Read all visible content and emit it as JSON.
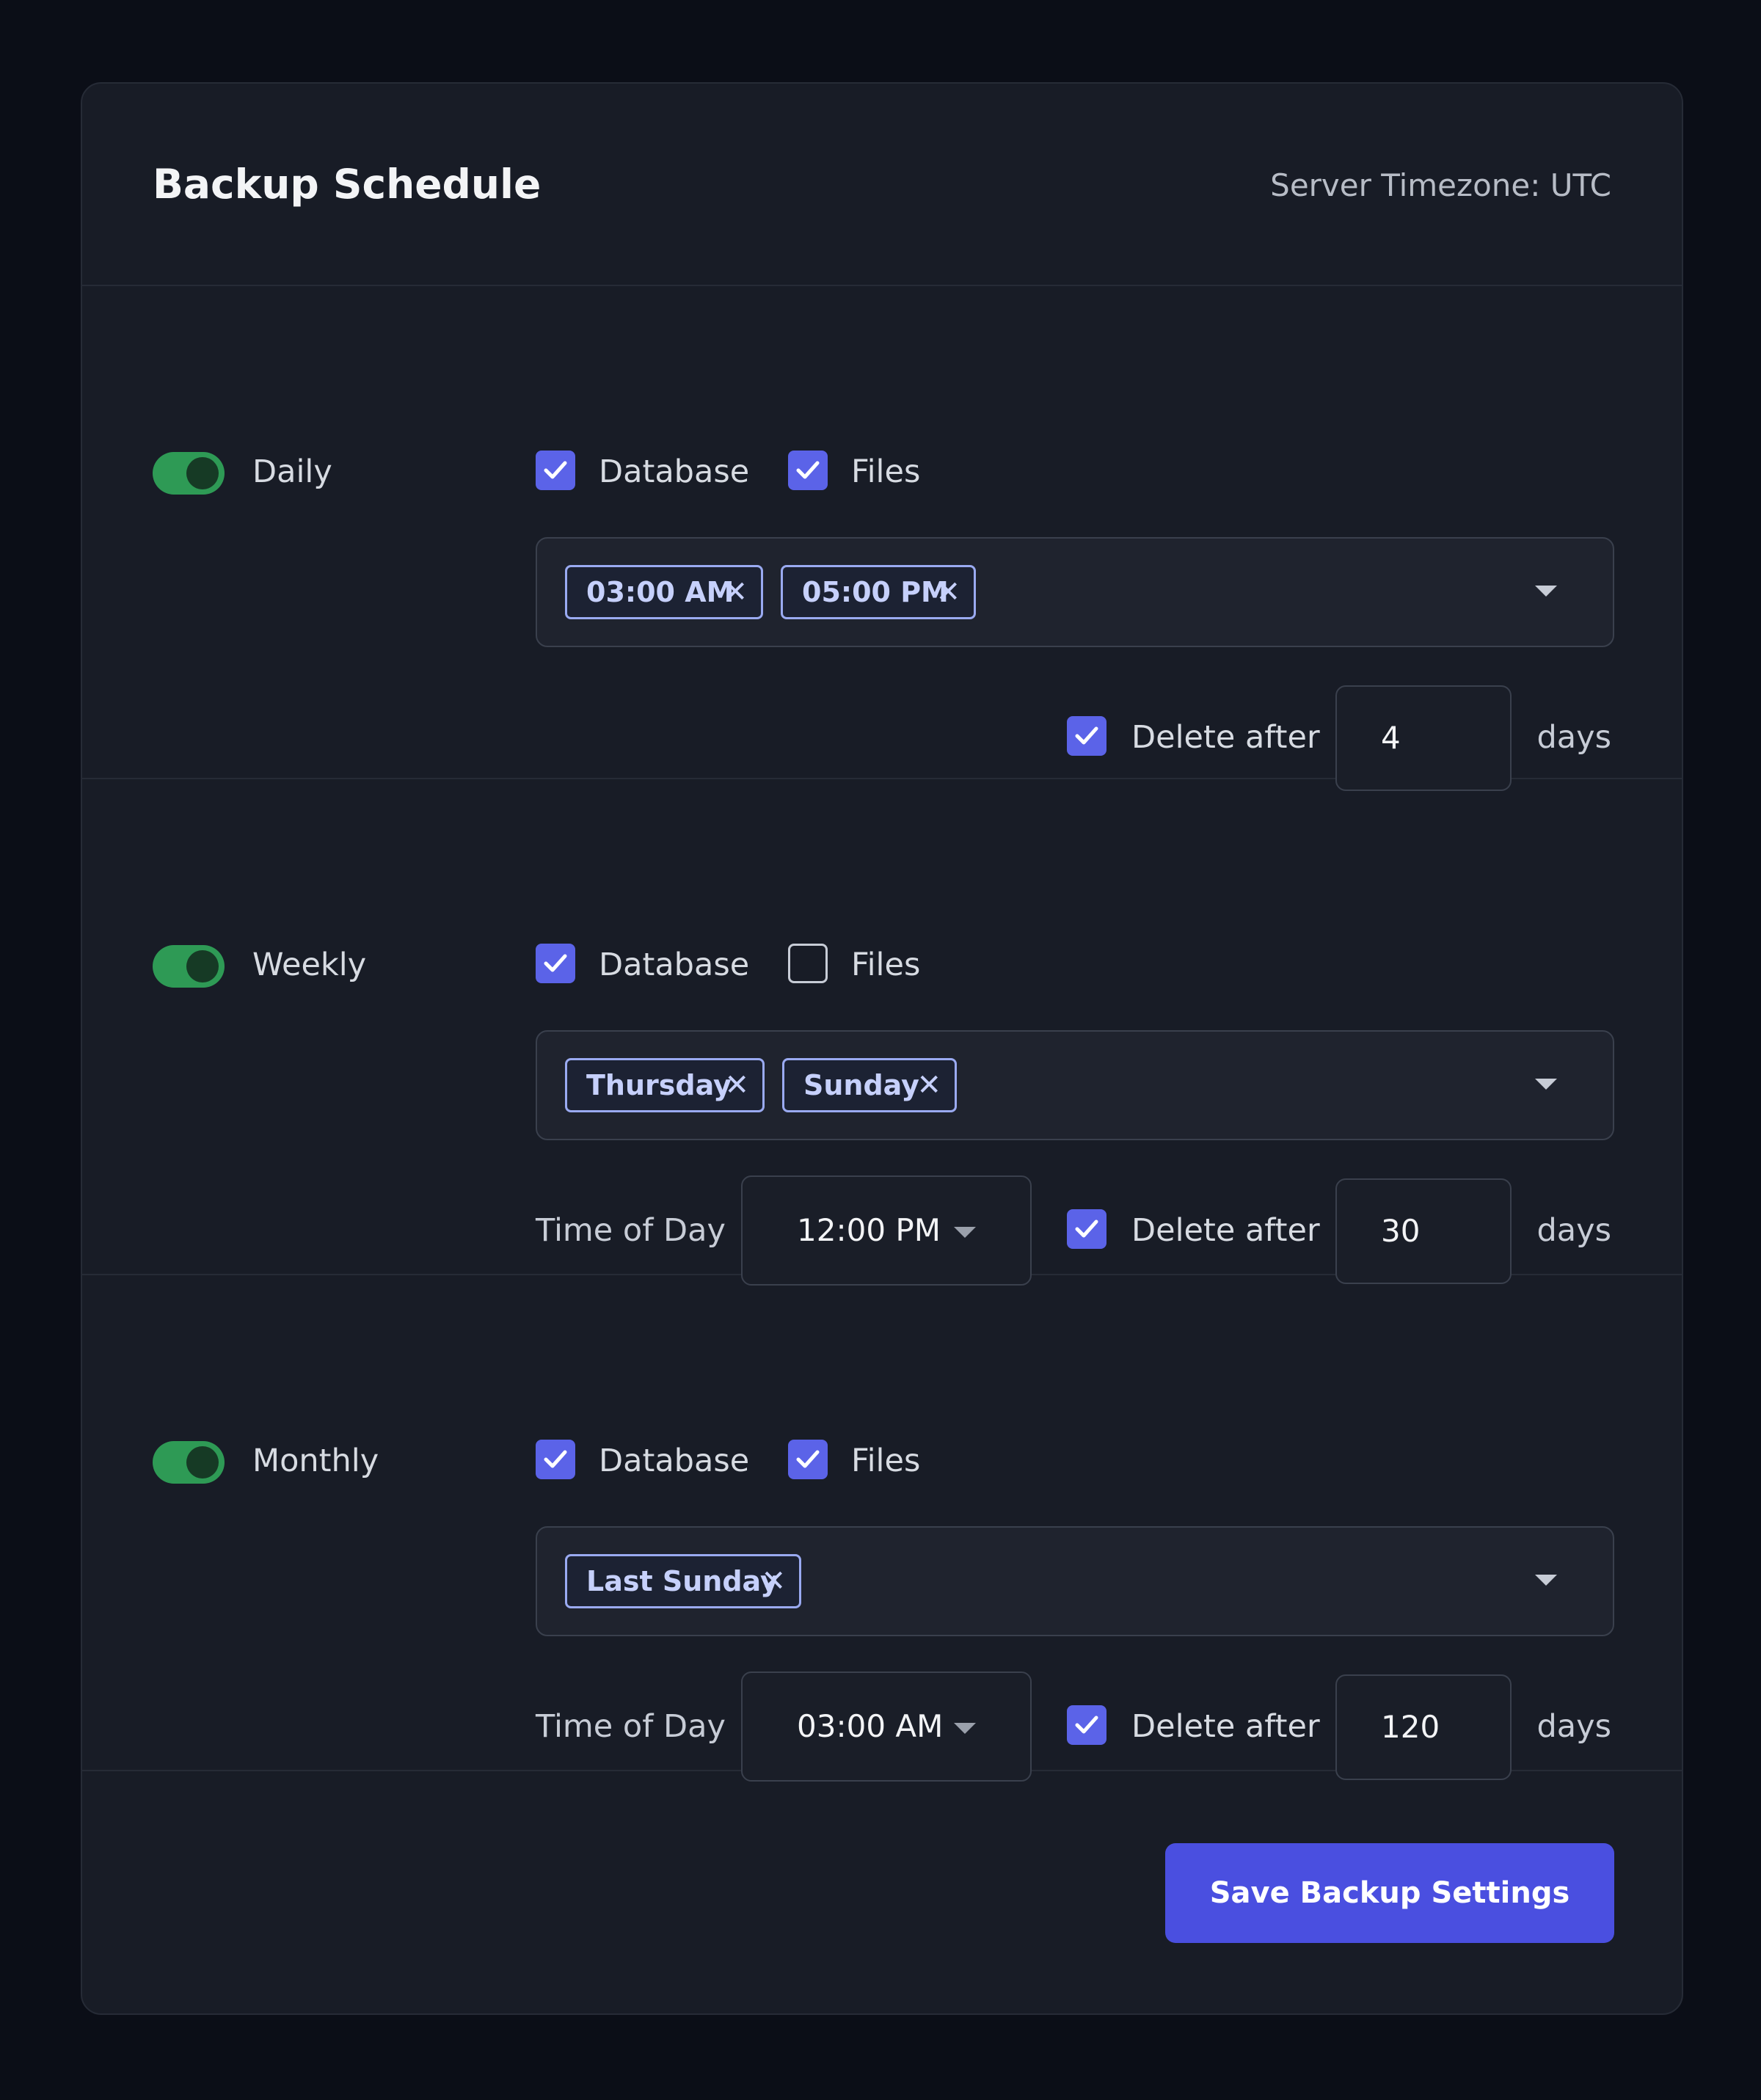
{
  "header": {
    "title": "Backup Schedule",
    "timezone": "Server Timezone: UTC"
  },
  "labels": {
    "database": "Database",
    "files": "Files",
    "time_of_day": "Time of Day",
    "delete_after": "Delete after",
    "days": "days"
  },
  "schedules": [
    {
      "name": "Daily",
      "enabled": true,
      "database_checked": true,
      "files_checked": true,
      "tags": [
        "03:00 AM",
        "05:00 PM"
      ],
      "delete_after_checked": true,
      "delete_after_days": "4"
    },
    {
      "name": "Weekly",
      "enabled": true,
      "database_checked": true,
      "files_checked": false,
      "tags": [
        "Thursday",
        "Sunday"
      ],
      "time_of_day": "12:00 PM",
      "delete_after_checked": true,
      "delete_after_days": "30"
    },
    {
      "name": "Monthly",
      "enabled": true,
      "database_checked": true,
      "files_checked": true,
      "tags": [
        "Last Sunday"
      ],
      "time_of_day": "03:00 AM",
      "delete_after_checked": true,
      "delete_after_days": "120"
    }
  ],
  "tag_remove_glyph": "✕",
  "save_label": "Save Backup Settings",
  "colors": {
    "accent": "#5b63e8",
    "toggle_on": "#2e9a55",
    "button": "#4a4fe0",
    "card": "#181c26",
    "background": "#0b0e17"
  }
}
